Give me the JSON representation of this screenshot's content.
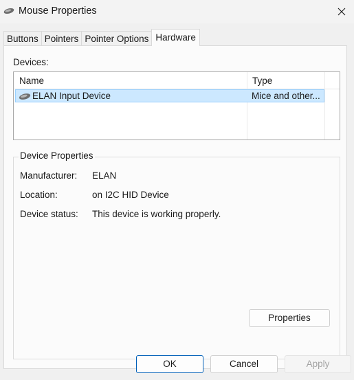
{
  "window": {
    "title": "Mouse Properties"
  },
  "tabs": [
    {
      "label": "Buttons"
    },
    {
      "label": "Pointers"
    },
    {
      "label": "Pointer Options"
    },
    {
      "label": "Hardware"
    }
  ],
  "devices": {
    "label": "Devices:",
    "columns": {
      "name": "Name",
      "type": "Type"
    },
    "rows": [
      {
        "name": "ELAN Input Device",
        "type": "Mice and other..."
      }
    ]
  },
  "device_properties": {
    "title": "Device Properties",
    "manufacturer_label": "Manufacturer:",
    "manufacturer_value": "ELAN",
    "location_label": "Location:",
    "location_value": "on I2C HID Device",
    "status_label": "Device status:",
    "status_value": "This device is working properly.",
    "properties_button": "Properties"
  },
  "footer": {
    "ok": "OK",
    "cancel": "Cancel",
    "apply": "Apply"
  },
  "icons": {
    "app": "mouse-icon",
    "close": "close-icon"
  },
  "colors": {
    "selection": "#cce8ff",
    "default_button_border": "#005fb8"
  }
}
